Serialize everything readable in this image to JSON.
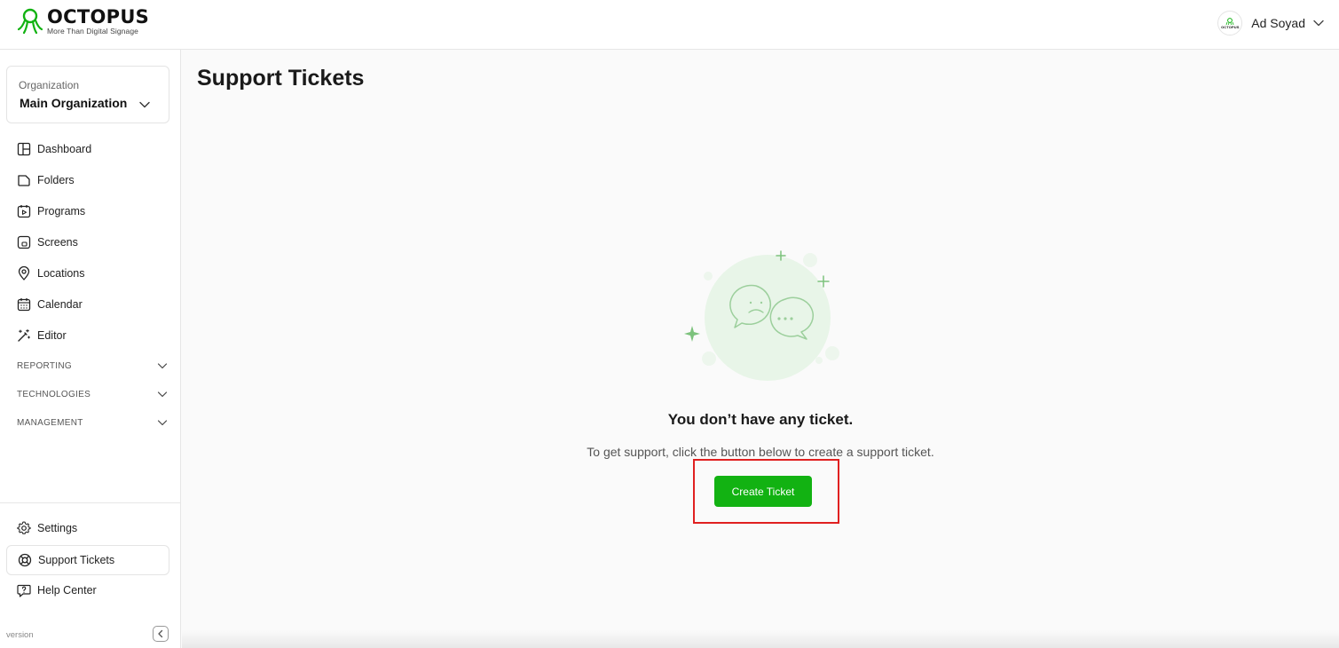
{
  "brand": {
    "name": "OCTOPUS",
    "tagline": "More Than Digital Signage",
    "accent_color": "#12b212"
  },
  "user": {
    "name": "Ad Soyad",
    "avatar_text": "OCTOPUS"
  },
  "organization": {
    "label": "Organization",
    "value": "Main Organization"
  },
  "nav": {
    "items": [
      {
        "label": "Dashboard",
        "icon": "layout-icon"
      },
      {
        "label": "Folders",
        "icon": "folder-icon"
      },
      {
        "label": "Programs",
        "icon": "calendar-play-icon"
      },
      {
        "label": "Screens",
        "icon": "screen-icon"
      },
      {
        "label": "Locations",
        "icon": "location-pin-icon"
      },
      {
        "label": "Calendar",
        "icon": "calendar-icon"
      },
      {
        "label": "Editor",
        "icon": "magic-wand-icon"
      }
    ],
    "sections": [
      "REPORTING",
      "TECHNOLOGIES",
      "MANAGEMENT"
    ],
    "bottom_items": [
      {
        "label": "Settings",
        "icon": "gear-icon"
      },
      {
        "label": "Support Tickets",
        "icon": "lifebuoy-icon",
        "active": true
      },
      {
        "label": "Help Center",
        "icon": "help-bubble-icon"
      }
    ],
    "version_label": "version"
  },
  "main": {
    "title": "Support Tickets",
    "empty_title": "You don’t have any ticket.",
    "empty_subtitle": "To get support, click the button below to create a support ticket.",
    "create_button": "Create Ticket",
    "illustration_icon": "chat-bubbles-icon"
  }
}
